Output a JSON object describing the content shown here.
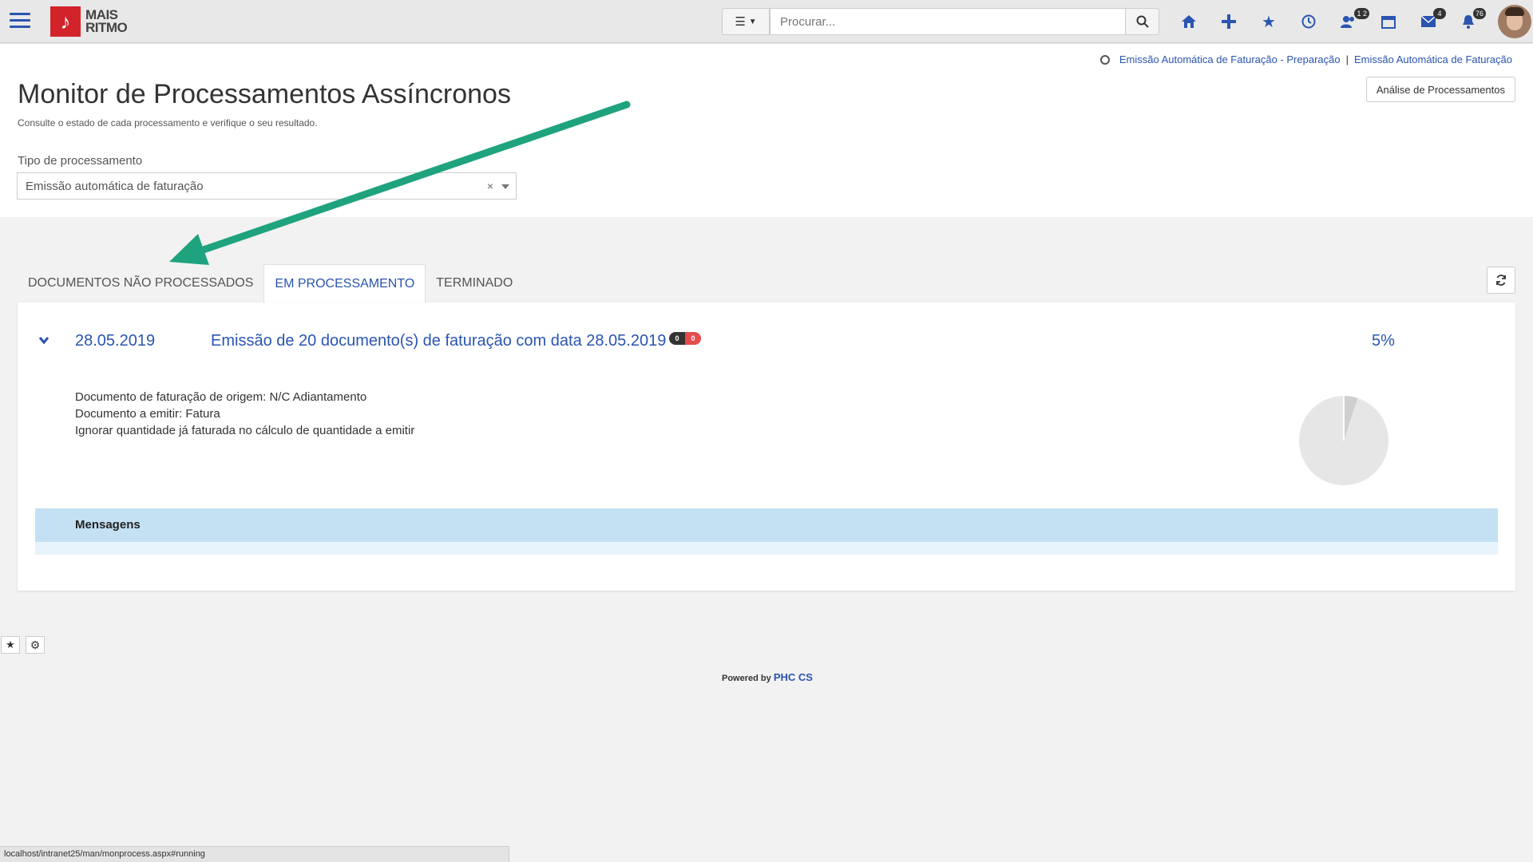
{
  "topbar": {
    "logo_line1": "MAIS",
    "logo_line2": "RITMO",
    "search_placeholder": "Procurar...",
    "badges": {
      "users": "1 2",
      "mail": "4",
      "notifications": "76"
    }
  },
  "breadcrumbs": {
    "item1": "Emissão Automática de Faturação - Preparação",
    "separator": "|",
    "item2": "Emissão Automática de Faturação"
  },
  "header": {
    "title": "Monitor de Processamentos Assíncronos",
    "subtitle": "Consulte o estado de cada processamento e verifique o seu resultado.",
    "analysis_button": "Análise de Processamentos"
  },
  "filter": {
    "label": "Tipo de processamento",
    "value": "Emissão automática de faturação",
    "clear": "×"
  },
  "tabs": [
    {
      "label": "DOCUMENTOS NÃO PROCESSADOS",
      "active": false
    },
    {
      "label": "EM PROCESSAMENTO",
      "active": true
    },
    {
      "label": "TERMINADO",
      "active": false
    }
  ],
  "process": {
    "date": "28.05.2019",
    "title": "Emissão de 20 documento(s) de faturação com data 28.05.2019",
    "pill_left": "0",
    "pill_right": "0",
    "percent": "5%",
    "progress_fraction": 0.05,
    "details": [
      "Documento de faturação de origem: N/C Adiantamento",
      "Documento a emitir: Fatura",
      "Ignorar quantidade já faturada no cálculo de quantidade a emitir"
    ],
    "messages_label": "Mensagens"
  },
  "footer": {
    "powered_by": "Powered by",
    "brand": "PHC CS",
    "status_url": "localhost/intranet25/man/monprocess.aspx#running"
  },
  "colors": {
    "accent": "#2a55b0",
    "annotation_arrow": "#1fa37e",
    "messages_bar": "#c4e0f3",
    "brand_red": "#d2232a"
  }
}
